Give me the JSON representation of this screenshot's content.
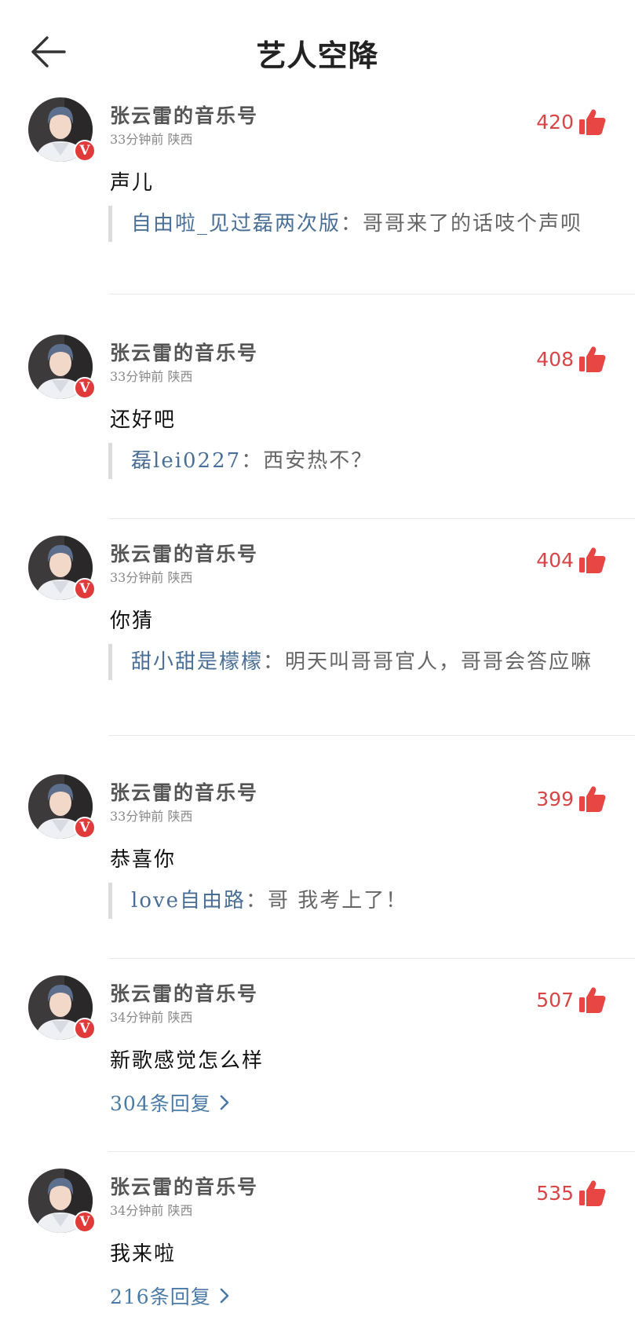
{
  "header": {
    "title": "艺人空降"
  },
  "comments": [
    {
      "name": "张云雷的音乐号",
      "meta": "33分钟前 陕西",
      "likes": "420",
      "content": "声儿",
      "quote_user": "自由啦_见过磊两次版",
      "quote_text": "：哥哥来了的话吱个声呗"
    },
    {
      "name": "张云雷的音乐号",
      "meta": "33分钟前 陕西",
      "likes": "408",
      "content": "还好吧",
      "quote_user": "磊lei0227",
      "quote_text": "：西安热不？"
    },
    {
      "name": "张云雷的音乐号",
      "meta": "33分钟前 陕西",
      "likes": "404",
      "content": "你猜",
      "quote_user": "甜小甜是檬檬",
      "quote_text": "：明天叫哥哥官人，哥哥会答应嘛"
    },
    {
      "name": "张云雷的音乐号",
      "meta": "33分钟前 陕西",
      "likes": "399",
      "content": "恭喜你",
      "quote_user": "love自由路",
      "quote_text": "：哥 我考上了！"
    },
    {
      "name": "张云雷的音乐号",
      "meta": "34分钟前 陕西",
      "likes": "507",
      "content": "新歌感觉怎么样",
      "replies": "304条回复"
    },
    {
      "name": "张云雷的音乐号",
      "meta": "34分钟前 陕西",
      "likes": "535",
      "content": "我来啦",
      "replies": "216条回复"
    }
  ],
  "colors": {
    "like": "#d94545",
    "link": "#4a6f96",
    "badge": "#e03a3a"
  }
}
